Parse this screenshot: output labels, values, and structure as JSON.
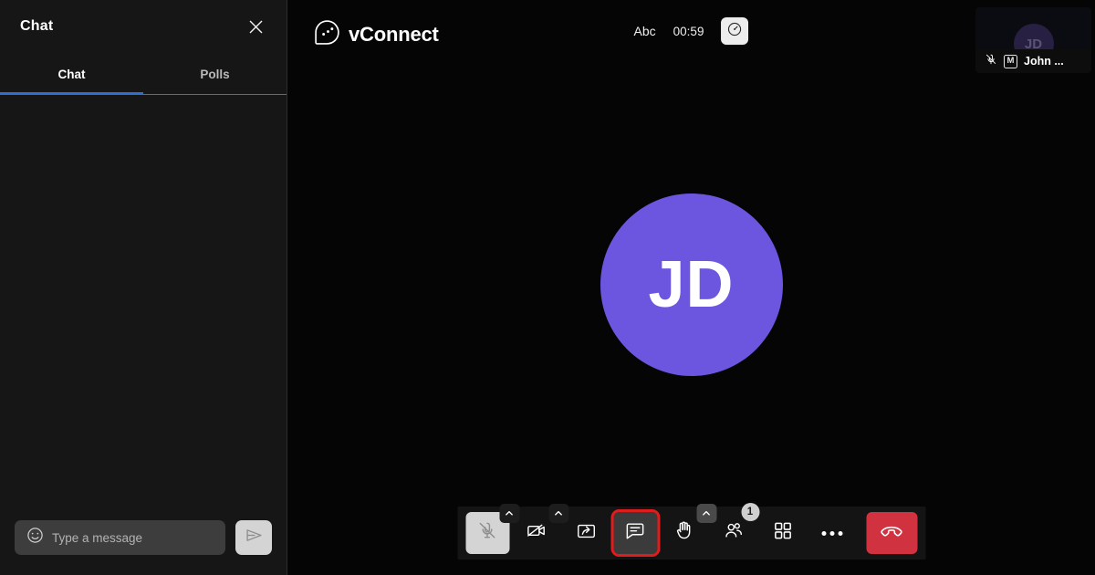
{
  "chat_panel": {
    "title": "Chat",
    "close_icon": "close-icon",
    "tabs": [
      {
        "label": "Chat",
        "active": true
      },
      {
        "label": "Polls",
        "active": false
      }
    ],
    "messages": [],
    "composer": {
      "emoji_icon": "emoji-smiley-icon",
      "placeholder": "Type a message",
      "value": "",
      "send_icon": "send-paper-plane-icon"
    }
  },
  "topbar": {
    "logo_icon": "vconnect-speech-bubble-logo",
    "brand": "vConnect",
    "caption_label": "Abc",
    "timer": "00:59",
    "quality_icon": "network-quality-gauge-icon"
  },
  "thumbnail": {
    "initials": "JD",
    "mic_icon": "microphone-muted-icon",
    "moderator_badge": "M",
    "name": "John ..."
  },
  "stage": {
    "speaker_initials": "JD"
  },
  "controls": [
    {
      "name": "microphone-button",
      "icon": "microphone-muted-icon",
      "state": "muted",
      "has_chevron": true,
      "label": ""
    },
    {
      "name": "camera-button",
      "icon": "camera-off-icon",
      "state": "off",
      "has_chevron": true,
      "label": ""
    },
    {
      "name": "share-screen-button",
      "icon": "share-screen-icon",
      "state": "default",
      "has_chevron": false,
      "label": ""
    },
    {
      "name": "chat-button",
      "icon": "chat-bubble-icon",
      "state": "focused",
      "has_chevron": false,
      "label": ""
    },
    {
      "name": "raise-hand-button",
      "icon": "raise-hand-icon",
      "state": "default",
      "has_chevron": true,
      "label": ""
    },
    {
      "name": "participants-button",
      "icon": "participants-icon",
      "state": "default",
      "has_chevron": false,
      "badge": "1",
      "label": ""
    },
    {
      "name": "layout-grid-button",
      "icon": "grid-layout-icon",
      "state": "default",
      "has_chevron": false,
      "label": ""
    },
    {
      "name": "more-options-button",
      "icon": "more-horizontal-icon",
      "state": "default",
      "has_chevron": false,
      "label": ""
    },
    {
      "name": "end-call-button",
      "icon": "end-call-handset-icon",
      "state": "danger",
      "has_chevron": false,
      "label": ""
    }
  ],
  "colors": {
    "accent_purple": "#6c56e0",
    "tab_indicator_blue": "#2f6fd0",
    "focus_red": "#e01d1d",
    "end_call_red": "#d0333f",
    "panel_bg": "#161616",
    "stage_bg": "#050505",
    "toolbar_bg": "#141414"
  }
}
